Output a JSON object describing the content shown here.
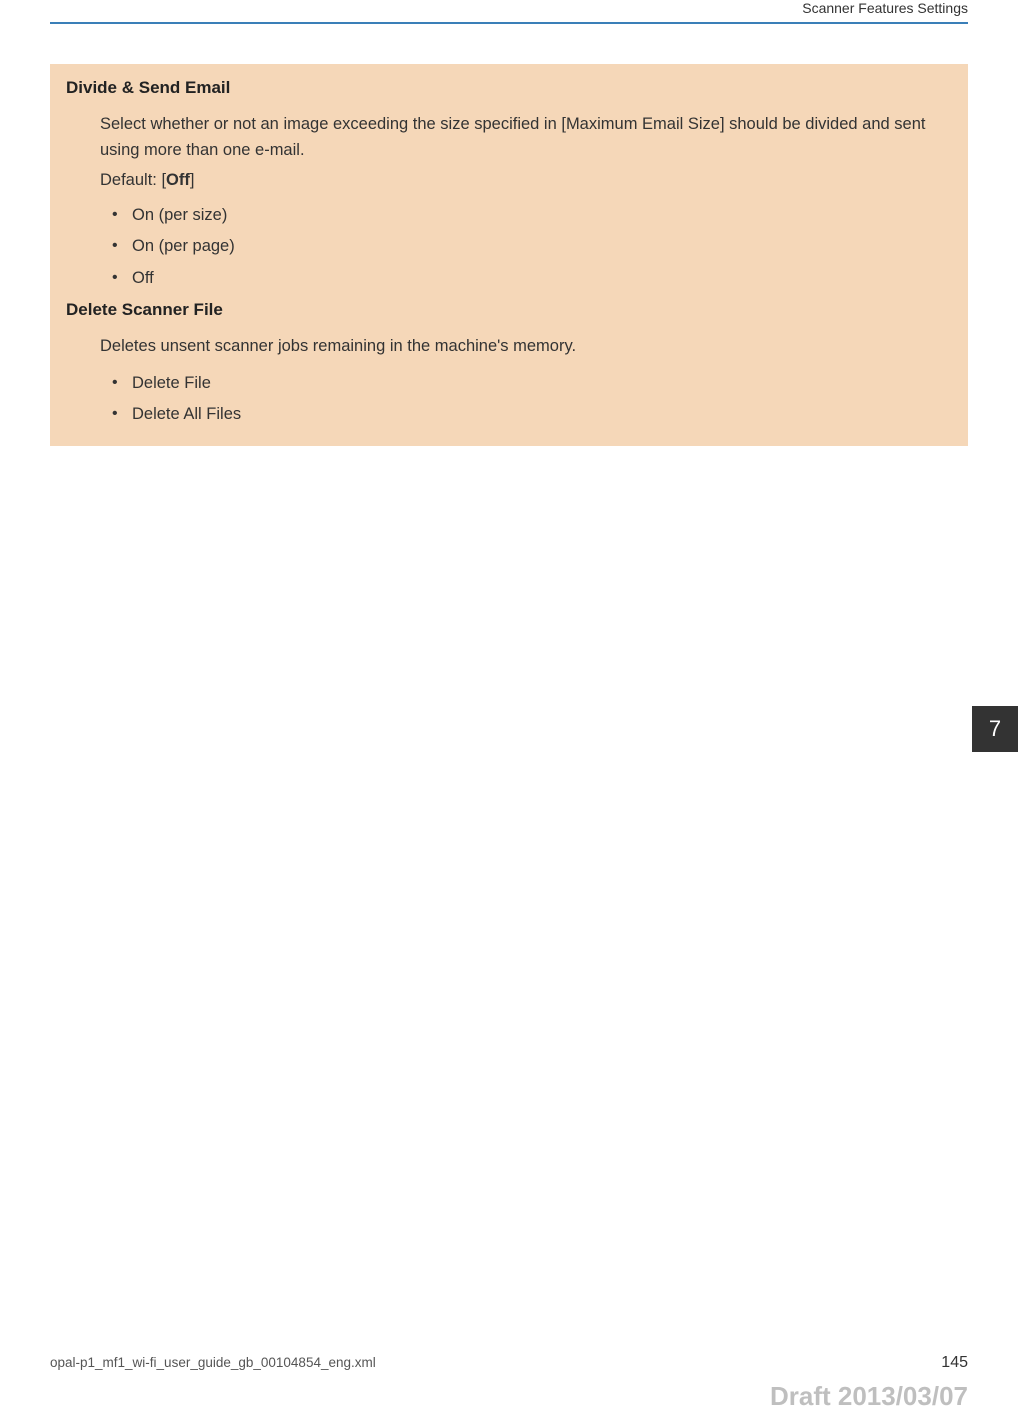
{
  "header": {
    "title": "Scanner Features Settings"
  },
  "chapter": {
    "number": "7"
  },
  "sections": [
    {
      "title": "Divide & Send Email",
      "description": "Select whether or not an image exceeding the size specified in [Maximum Email Size] should be divided and sent using more than one e-mail.",
      "default_label": "Default: [",
      "default_value": "Off",
      "default_close": "]",
      "options": [
        "On (per size)",
        "On (per page)",
        "Off"
      ]
    },
    {
      "title": "Delete Scanner File",
      "description": "Deletes unsent scanner jobs remaining in the machine's memory.",
      "options": [
        "Delete File",
        "Delete All Files"
      ]
    }
  ],
  "footer": {
    "file_path": "opal-p1_mf1_wi-fi_user_guide_gb_00104854_eng.xml",
    "page_number": "145"
  },
  "draft": "Draft 2013/03/07"
}
